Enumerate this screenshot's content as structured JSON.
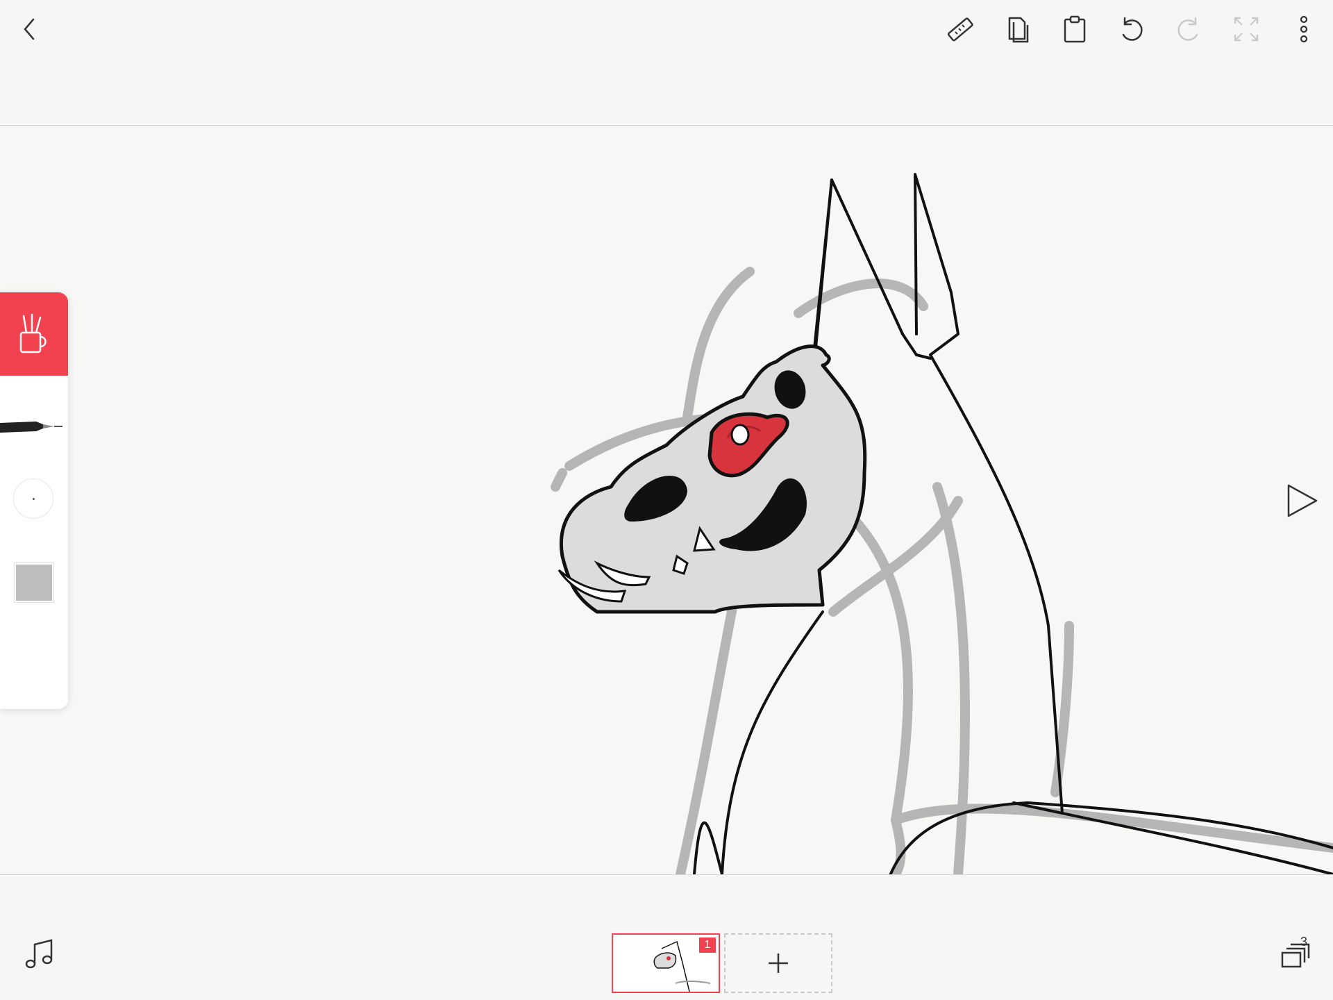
{
  "toolbar": {
    "icons": [
      "back-icon",
      "ruler-icon",
      "copy-icon",
      "paste-icon",
      "undo-icon",
      "redo-icon",
      "fullscreen-icon",
      "more-icon"
    ]
  },
  "colors": {
    "accent": "#f2414f",
    "current_color": "#bdbdbd",
    "background": "#f6f6f6"
  },
  "tools": {
    "active_tool": "pen",
    "icons": [
      "tools-cup-icon",
      "pen-icon",
      "brush-size-icon",
      "color-swatch"
    ]
  },
  "timeline": {
    "frames": [
      {
        "number": "1",
        "selected": true
      }
    ],
    "layers_count": "3"
  }
}
